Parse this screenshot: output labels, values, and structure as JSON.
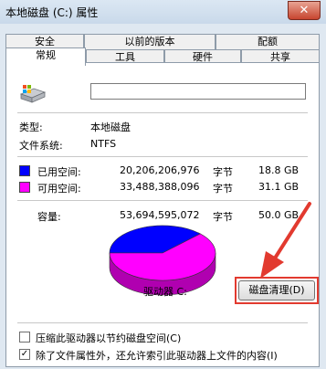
{
  "window": {
    "title": "本地磁盘 (C:) 属性",
    "close": "✕"
  },
  "tabs_top": [
    "安全",
    "以前的版本",
    "配额"
  ],
  "tabs_bottom": [
    "常规",
    "工具",
    "硬件",
    "共享"
  ],
  "active_tab": "常规",
  "name_input": {
    "value": ""
  },
  "info": {
    "type_label": "类型:",
    "type_value": "本地磁盘",
    "fs_label": "文件系统:",
    "fs_value": "NTFS"
  },
  "used": {
    "label": "已用空间:",
    "bytes": "20,206,206,976",
    "unit": "字节",
    "size": "18.8 GB",
    "color": "#0000ff"
  },
  "free": {
    "label": "可用空间:",
    "bytes": "33,488,388,096",
    "unit": "字节",
    "size": "31.1 GB",
    "color": "#ff00ff"
  },
  "capacity": {
    "label": "容量:",
    "bytes": "53,694,595,072",
    "unit": "字节",
    "size": "50.0 GB"
  },
  "drive_label": "驱动器 C:",
  "cleanup_button": "磁盘清理(D)",
  "compress_checkbox": {
    "label": "压缩此驱动器以节约磁盘空间(C)",
    "checked": false
  },
  "index_checkbox": {
    "label": "除了文件属性外，还允许索引此驱动器上文件的内容(I)",
    "checked": true
  },
  "used_fraction": 0.376,
  "highlight_color": "#e23a2f"
}
